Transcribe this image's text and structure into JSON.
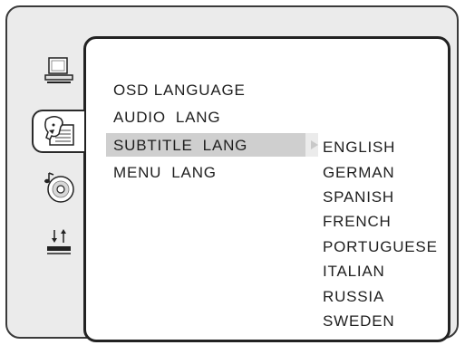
{
  "sidebar": {
    "icons": [
      {
        "name": "monitor-icon",
        "selected": false
      },
      {
        "name": "language-icon",
        "selected": true
      },
      {
        "name": "audio-disc-icon",
        "selected": false
      },
      {
        "name": "transfer-arrows-icon",
        "selected": false
      }
    ]
  },
  "menu": {
    "items": [
      {
        "label": "OSD LANGUAGE",
        "selected": false
      },
      {
        "label": "AUDIO  LANG",
        "selected": false
      },
      {
        "label": "SUBTITLE  LANG",
        "selected": true
      },
      {
        "label": "MENU  LANG",
        "selected": false
      }
    ]
  },
  "submenu": {
    "options": [
      "ENGLISH",
      "GERMAN",
      "SPANISH",
      "FRENCH",
      "PORTUGUESE",
      "ITALIAN",
      "RUSSIA",
      "SWEDEN"
    ],
    "selected_index": 0
  },
  "colors": {
    "frame_background": "#ebebeb",
    "panel_background": "#ffffff",
    "selected_row": "#cfcfcf",
    "text": "#1f1f1f"
  }
}
